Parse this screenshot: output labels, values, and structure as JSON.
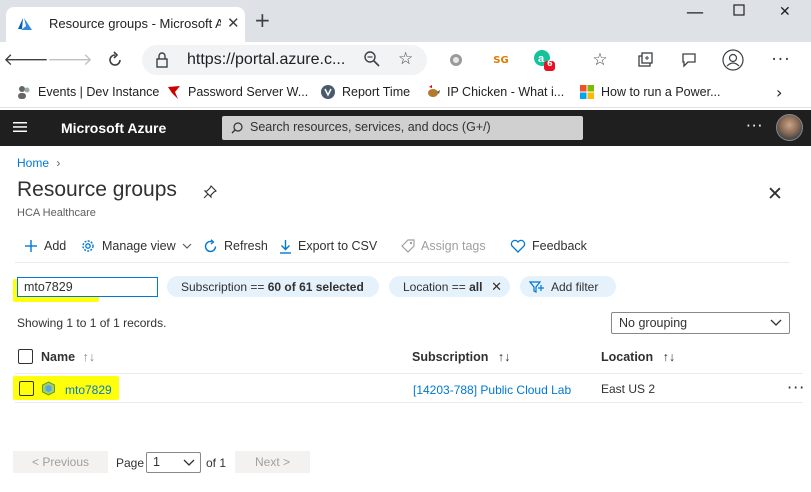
{
  "browser": {
    "tab_title": "Resource groups - Microsoft Azure",
    "url": "https://portal.azure.c...",
    "bookmarks": [
      {
        "label": "Events | Dev Instance",
        "icon": "user-group-icon"
      },
      {
        "label": "Password Server W...",
        "icon": "red-bird-icon"
      },
      {
        "label": "Report Time",
        "icon": "shield-v-icon"
      },
      {
        "label": "IP Chicken - What i...",
        "icon": "chicken-icon"
      },
      {
        "label": "How to run a Power...",
        "icon": "windows-icon"
      }
    ],
    "extension_badge": "6"
  },
  "azure": {
    "brand": "Microsoft Azure",
    "search_placeholder": "Search resources, services, and docs (G+/)"
  },
  "page": {
    "breadcrumb_home": "Home",
    "title": "Resource groups",
    "subtitle": "HCA Healthcare"
  },
  "commands": {
    "add": "Add",
    "manage_view": "Manage view",
    "refresh": "Refresh",
    "export": "Export to CSV",
    "assign_tags": "Assign tags",
    "feedback": "Feedback"
  },
  "filters": {
    "search_value": "mto7829",
    "subscription_prefix": "Subscription ==",
    "subscription_value": "60 of 61 selected",
    "location_prefix": "Location ==",
    "location_value": "all",
    "add_filter": "Add filter"
  },
  "records_text": "Showing 1 to 1 of 1 records.",
  "grouping_value": "No grouping",
  "table": {
    "columns": [
      "Name",
      "Subscription",
      "Location"
    ],
    "rows": [
      {
        "name": "mto7829",
        "subscription": "[14203-788] Public Cloud Lab",
        "location": "East US 2"
      }
    ]
  },
  "pagination": {
    "previous": "< Previous",
    "page_label": "Page",
    "page_value": "1",
    "of_label": "of 1",
    "next": "Next >"
  },
  "colors": {
    "accent": "#0078d4",
    "highlight": "#ffff0b",
    "header_bg": "#1f1f1f"
  }
}
